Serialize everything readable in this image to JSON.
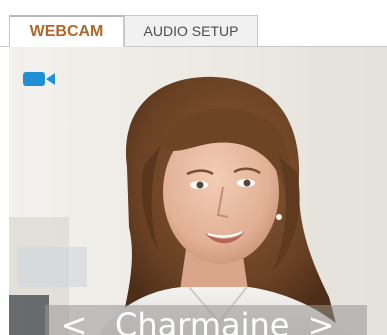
{
  "tabs": [
    {
      "label": "WEBCAM",
      "active": true
    },
    {
      "label": "AUDIO SETUP",
      "active": false
    }
  ],
  "video": {
    "camera_icon": "video-camera-icon",
    "caption": {
      "prev_label": "<",
      "name": "Charmaine",
      "next_label": ">"
    }
  },
  "colors": {
    "active_tab_text": "#b0682a",
    "inactive_tab_bg": "#f1f1f1",
    "camera_icon": "#1f8fd6"
  }
}
